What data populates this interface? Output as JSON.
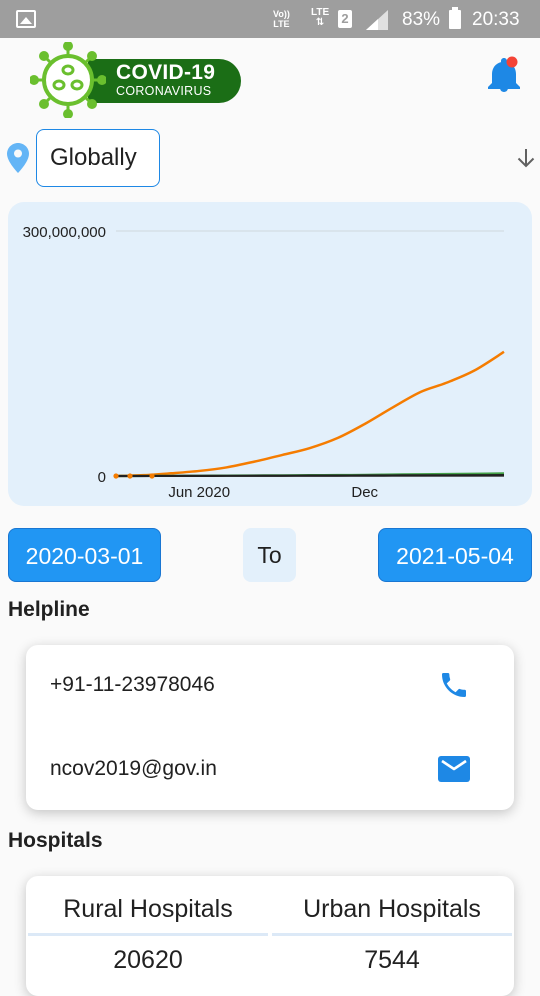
{
  "status_bar": {
    "volte_label": "Vo)) LTE",
    "network_label": "LTE",
    "sim_slot": "2",
    "battery_percent": "83%",
    "time": "20:33"
  },
  "header": {
    "logo_title": "COVID-19",
    "logo_subtitle": "CORONAVIRUS",
    "notification_dot_color": "#f44336",
    "brand_color": "#1b6e16"
  },
  "location": {
    "selected": "Globally"
  },
  "chart_data": {
    "type": "line",
    "x": [
      "2020-03-01",
      "2020-04-01",
      "2020-05-01",
      "2020-06-01",
      "2020-07-01",
      "2020-08-01",
      "2020-09-01",
      "2020-10-01",
      "2020-11-01",
      "2020-12-01",
      "2021-01-01",
      "2021-02-01",
      "2021-03-01",
      "2021-04-01",
      "2021-05-04"
    ],
    "x_tick_labels": [
      {
        "label": "Jun 2020",
        "x": "2020-06-01"
      },
      {
        "label": "Dec",
        "x": "2020-12-01"
      }
    ],
    "y_tick_labels": [
      "0",
      "300,000,000"
    ],
    "ylim": [
      0,
      300000000
    ],
    "series": [
      {
        "color": "#f57c00",
        "values": [
          0,
          1000000,
          3300000,
          6200000,
          10500000,
          17600000,
          25800000,
          34100000,
          46500000,
          63700000,
          84000000,
          103000000,
          114000000,
          129000000,
          152000000
        ]
      },
      {
        "color": "#43a047",
        "values": [
          0,
          50000,
          230000,
          380000,
          510000,
          680000,
          850000,
          1030000,
          1200000,
          1480000,
          1830000,
          2230000,
          2550000,
          2800000,
          3250000
        ]
      },
      {
        "color": "#212121",
        "values": [
          0,
          30000,
          100000,
          160000,
          210000,
          280000,
          340000,
          430000,
          500000,
          600000,
          680000,
          800000,
          850000,
          950000,
          1100000
        ]
      }
    ],
    "grid": true
  },
  "date_range": {
    "from": "2020-03-01",
    "to_label": "To",
    "to": "2021-05-04"
  },
  "helpline": {
    "title": "Helpline",
    "phone": "+91-11-23978046",
    "email": "ncov2019@gov.in",
    "icon_color": "#1e88e5"
  },
  "hospitals": {
    "title": "Hospitals",
    "columns": [
      {
        "label": "Rural Hospitals",
        "value": "20620"
      },
      {
        "label": "Urban Hospitals",
        "value": "7544"
      }
    ]
  }
}
